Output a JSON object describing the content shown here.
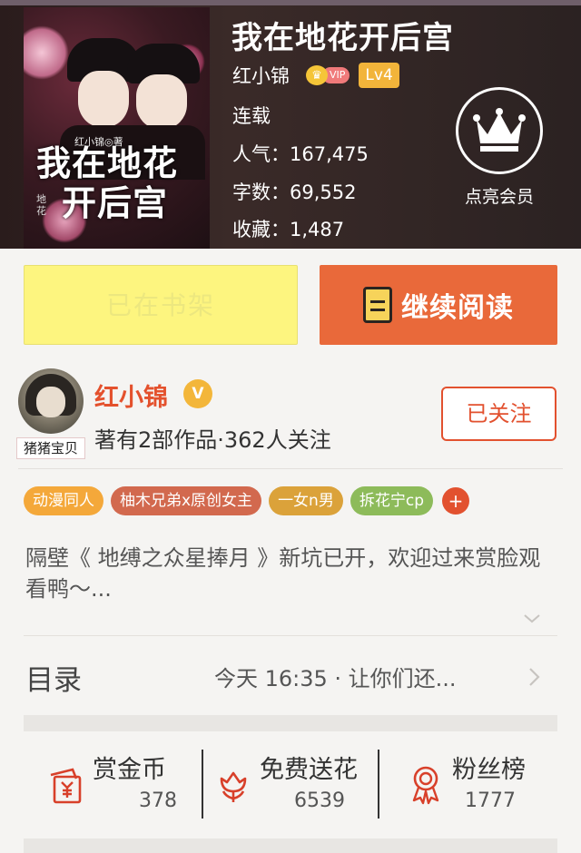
{
  "book": {
    "title": "我在地花开后宫",
    "author": "红小锦",
    "vip_label": "VIP",
    "level": "Lv4",
    "status": "连载",
    "popularity": "人气：167,475",
    "word_count": "字数：69,552",
    "favorites": "收藏：1,487",
    "cover": {
      "author_text": "红小锦◎著",
      "title_line1": "我在地花",
      "title_line2": "开后宫",
      "side_text": "地花"
    }
  },
  "vip_member": {
    "label": "点亮会员"
  },
  "actions": {
    "shelf_label": "已在书架",
    "read_label": "继续阅读"
  },
  "author_card": {
    "name": "红小锦",
    "verified": "V",
    "avatar_tag": "猪猪宝贝",
    "summary": "著有2部作品·362人关注",
    "follow_label": "已关注"
  },
  "tags": [
    {
      "label": "动漫同人",
      "color": "#f4a83a"
    },
    {
      "label": "柚木兄弟x原创女主",
      "color": "#d2694e"
    },
    {
      "label": "一女n男",
      "color": "#dba23a"
    },
    {
      "label": "拆花宁cp",
      "color": "#8dbb5a"
    }
  ],
  "tags_more": "+",
  "description": "隔壁《 地缚之众星捧月 》新坑已开，欢迎过来赏脸观看鸭～...",
  "toc": {
    "label": "目录",
    "latest": "今天 16:35 · 让你们还..."
  },
  "stats": [
    {
      "title": "赏金币",
      "value": "378",
      "icon": "red-envelope-icon"
    },
    {
      "title": "免费送花",
      "value": "6539",
      "icon": "flower-icon"
    },
    {
      "title": "粉丝榜",
      "value": "1777",
      "icon": "medal-icon"
    }
  ],
  "colors": {
    "accent": "#e9693a",
    "shelf": "#fdf57f",
    "icon_red": "#d8402a"
  }
}
